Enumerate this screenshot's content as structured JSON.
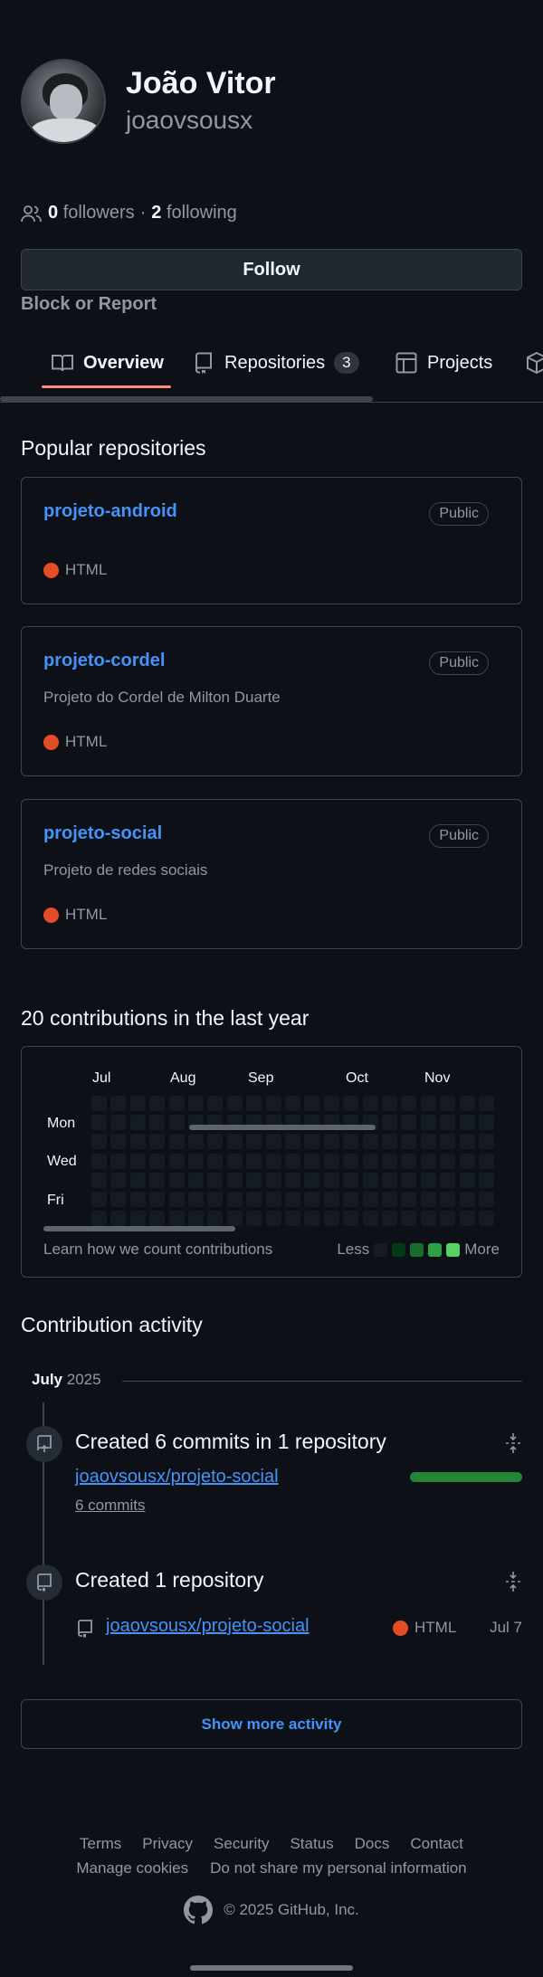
{
  "profile": {
    "name": "João Vitor",
    "login": "joaovsousx",
    "followers_count": "0",
    "followers_label": "followers",
    "separator": "·",
    "following_count": "2",
    "following_label": "following",
    "follow_button": "Follow",
    "block_report": "Block or Report"
  },
  "tabs": {
    "overview": "Overview",
    "repositories": "Repositories",
    "repositories_count": "3",
    "projects": "Projects"
  },
  "popular": {
    "heading": "Popular repositories",
    "repos": [
      {
        "name": "projeto-android",
        "visibility": "Public",
        "description": "",
        "language": "HTML"
      },
      {
        "name": "projeto-cordel",
        "visibility": "Public",
        "description": "Projeto do Cordel de Milton Duarte",
        "language": "HTML"
      },
      {
        "name": "projeto-social",
        "visibility": "Public",
        "description": "Projeto de redes sociais",
        "language": "HTML"
      }
    ],
    "language_color": "#e34c26"
  },
  "contributions": {
    "heading": "20 contributions in the last year",
    "months": [
      "Jul",
      "Aug",
      "Sep",
      "Oct",
      "Nov"
    ],
    "days": [
      "Mon",
      "Wed",
      "Fri"
    ],
    "learn_text": "Learn how we count contributions",
    "legend_less": "Less",
    "legend_more": "More",
    "legend_colors": [
      "#151b23",
      "#033a16",
      "#196c2e",
      "#2ea043",
      "#56d364"
    ]
  },
  "activity": {
    "heading": "Contribution activity",
    "month": "July",
    "year": "2025",
    "items": [
      {
        "title": "Created 6 commits in 1 repository",
        "repo": "joaovsousx/projeto-social",
        "detail": "6 commits"
      },
      {
        "title": "Created 1 repository",
        "repo": "joaovsousx/projeto-social",
        "language": "HTML",
        "date": "Jul 7"
      }
    ],
    "show_more": "Show more activity"
  },
  "footer": {
    "links": [
      "Terms",
      "Privacy",
      "Security",
      "Status",
      "Docs",
      "Contact"
    ],
    "links2": [
      "Manage cookies",
      "Do not share my personal information"
    ],
    "copyright": "© 2025 GitHub, Inc."
  }
}
